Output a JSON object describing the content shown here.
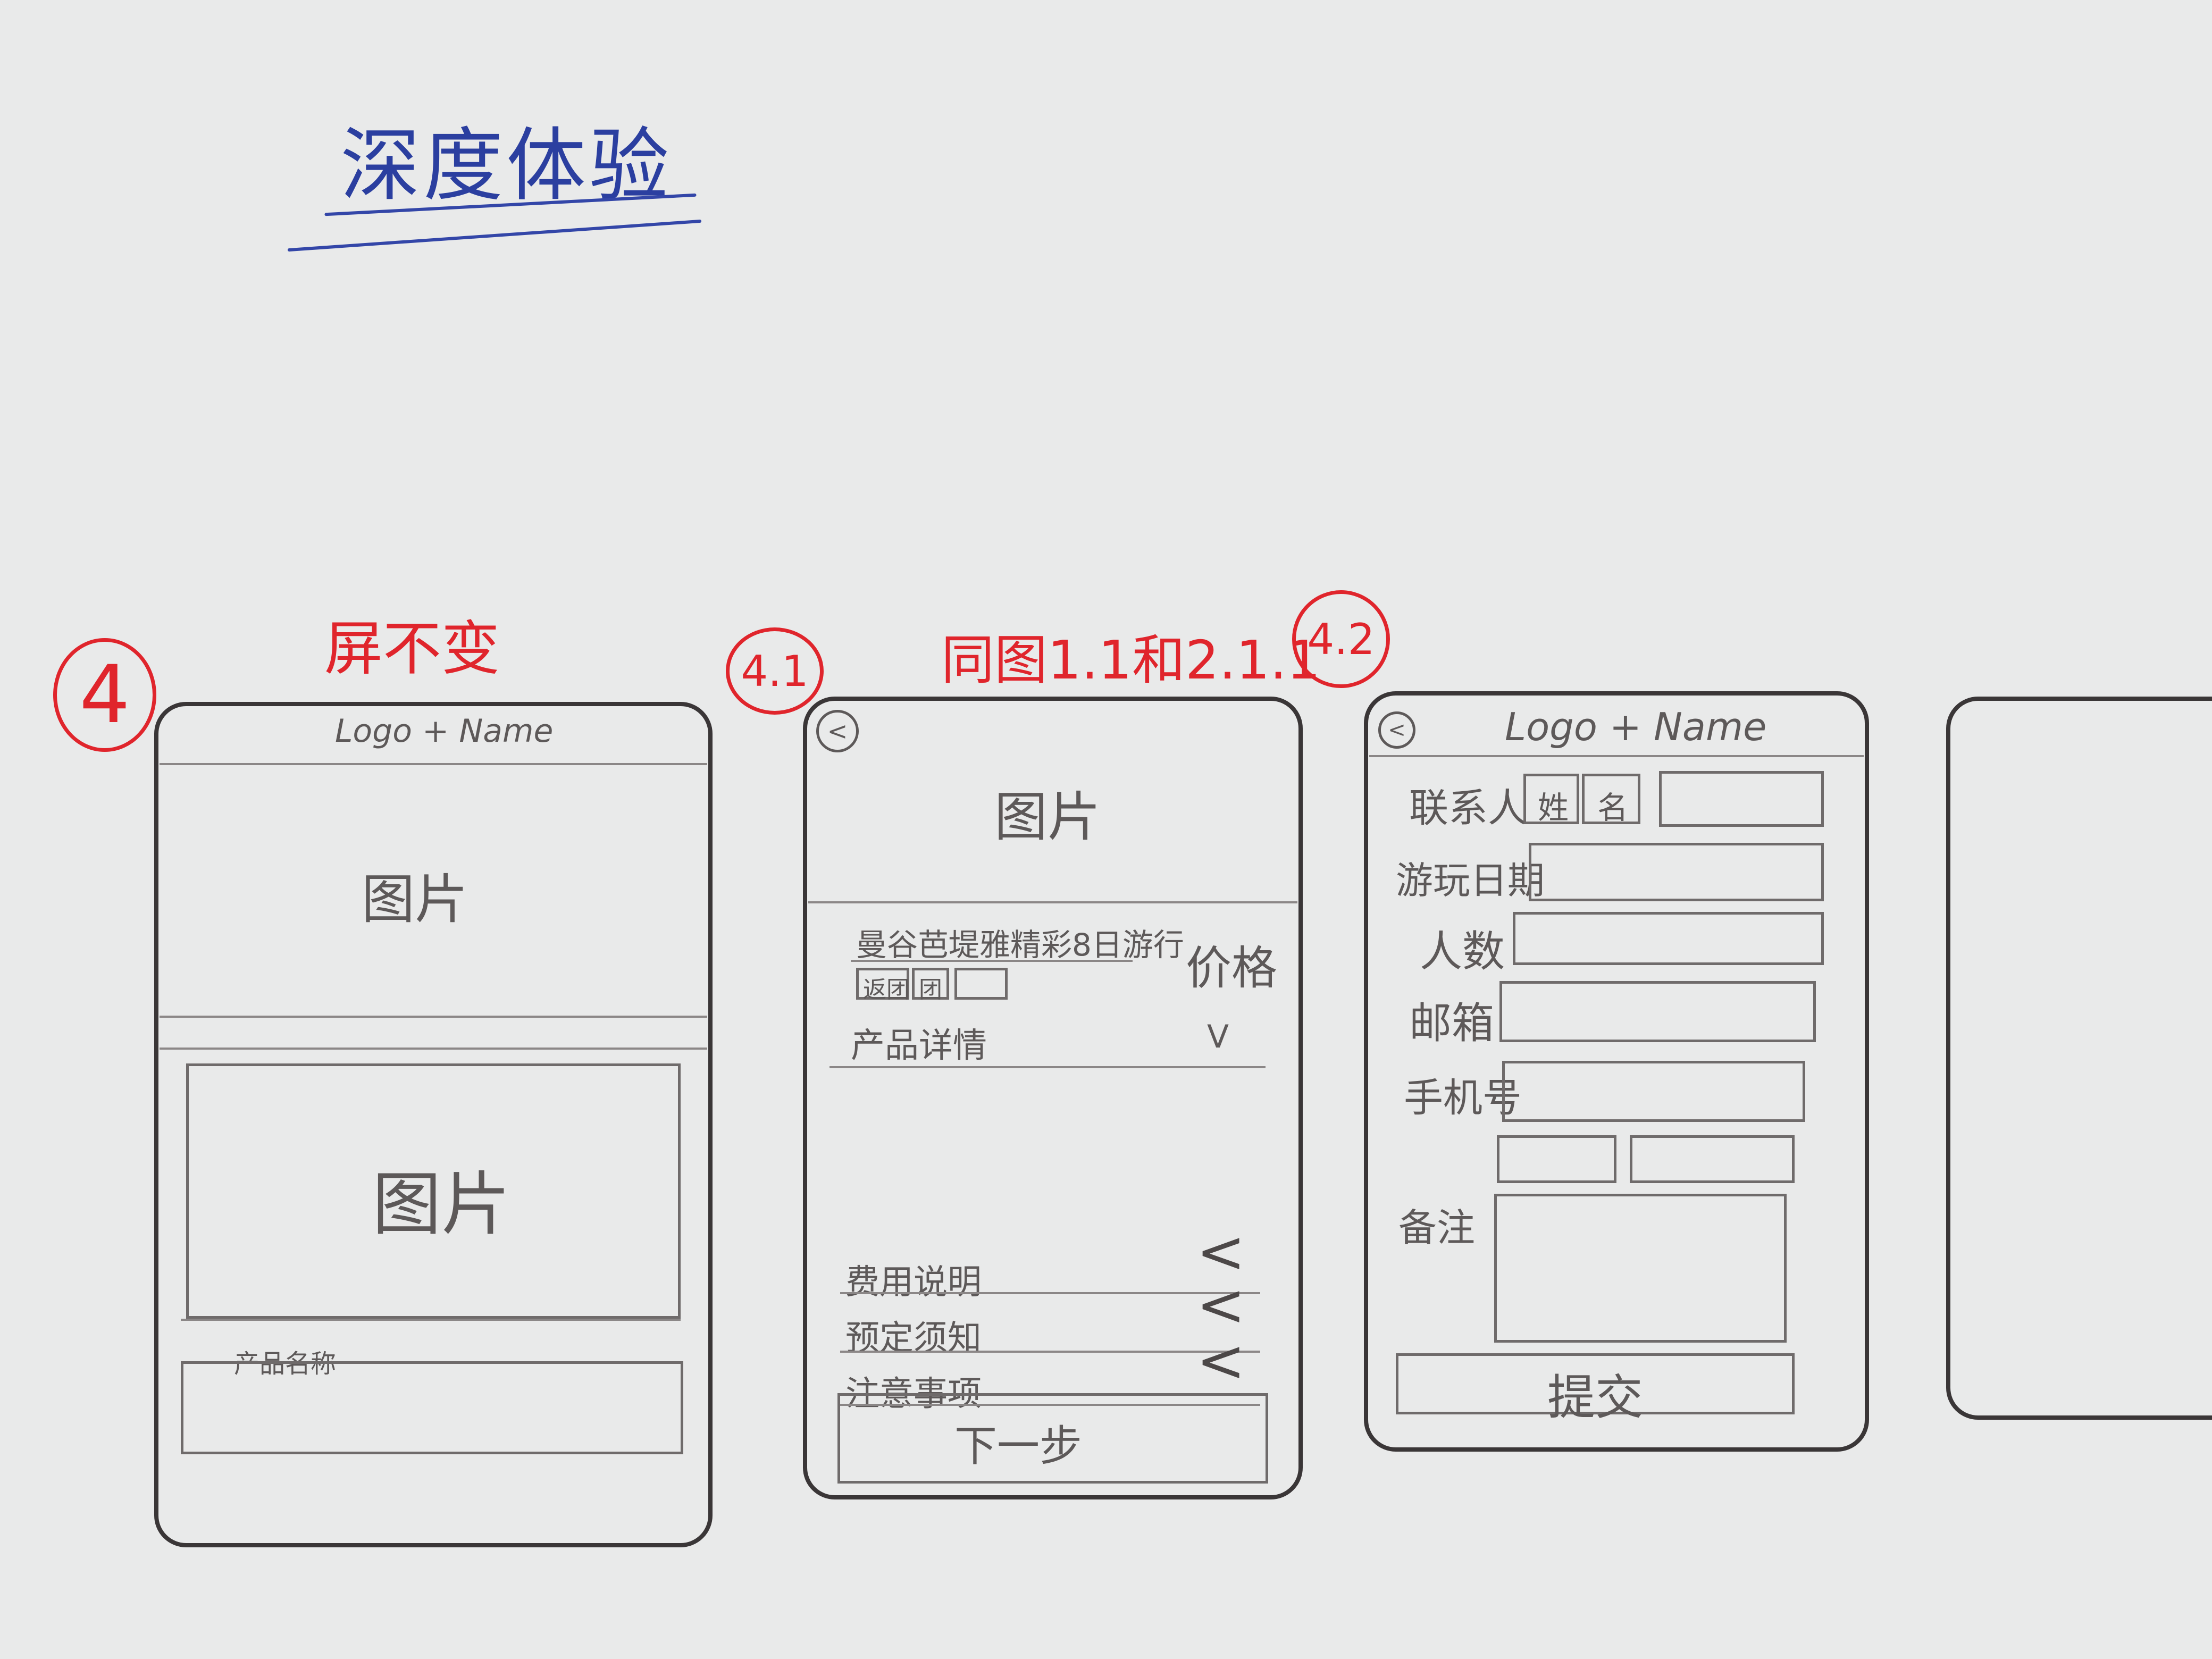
{
  "page": {
    "title": "深度体验"
  },
  "annotations": {
    "step_4": "4",
    "step_4_note": "屏不变",
    "step_4_1": "4.1",
    "step_4_1_note": "同图1.1和2.1.1",
    "step_4_2": "4.2"
  },
  "screen_4": {
    "header": "Logo + Name",
    "image_top": "图片",
    "image_bottom": "图片",
    "product_name": "产品名称"
  },
  "screen_4_1": {
    "back_icon": "<",
    "image": "图片",
    "product_title": "曼谷芭堤雅精彩8日游行",
    "tags": [
      "返团",
      "团"
    ],
    "price_label": "价格",
    "details_label": "产品详情",
    "details_toggle": "V",
    "sections": [
      {
        "label": "费用说明",
        "chevron": "<"
      },
      {
        "label": "预定须知",
        "chevron": "<"
      },
      {
        "label": "注意事项",
        "chevron": "<"
      }
    ],
    "next_button": "下一步"
  },
  "screen_4_2": {
    "back_icon": "<",
    "header": "Logo + Name",
    "fields": {
      "contact_label": "联系人",
      "surname_label": "姓",
      "name_label": "名",
      "travel_date_label": "游玩日期",
      "people_label": "人数",
      "email_label": "邮箱",
      "phone_label": "手机号",
      "remarks_label": "备注"
    },
    "submit_button": "提交"
  },
  "colors": {
    "ink": "#3a3637",
    "title_blue": "#2b3fa0",
    "annotation_red": "#e0252c",
    "paper": "#e9eaea"
  }
}
